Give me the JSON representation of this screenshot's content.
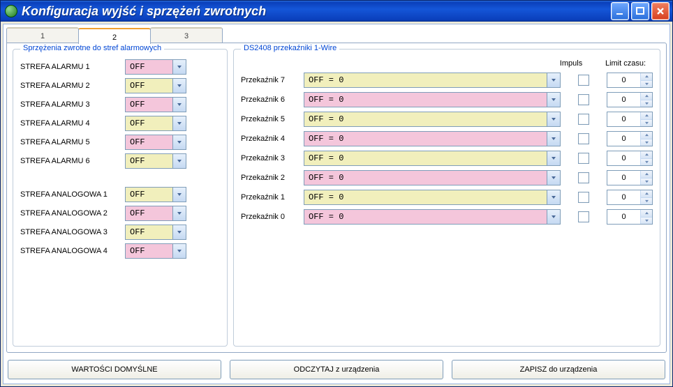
{
  "window": {
    "title": "Konfiguracja wyjść i sprzężeń zwrotnych"
  },
  "tabs": [
    "1",
    "2",
    "3"
  ],
  "active_tab": 1,
  "left_group": {
    "legend": "Sprzężenia zwrotne do stref alarmowych",
    "alarm": [
      {
        "label": "STREFA ALARMU 1",
        "value": "OFF",
        "color": "pink"
      },
      {
        "label": "STREFA ALARMU 2",
        "value": "OFF",
        "color": "yellow"
      },
      {
        "label": "STREFA ALARMU 3",
        "value": "OFF",
        "color": "pink"
      },
      {
        "label": "STREFA ALARMU 4",
        "value": "OFF",
        "color": "yellow"
      },
      {
        "label": "STREFA ALARMU 5",
        "value": "OFF",
        "color": "pink"
      },
      {
        "label": "STREFA ALARMU 6",
        "value": "OFF",
        "color": "yellow"
      }
    ],
    "analog": [
      {
        "label": "STREFA ANALOGOWA 1",
        "value": "OFF",
        "color": "yellow"
      },
      {
        "label": "STREFA ANALOGOWA 2",
        "value": "OFF",
        "color": "pink"
      },
      {
        "label": "STREFA ANALOGOWA 3",
        "value": "OFF",
        "color": "yellow"
      },
      {
        "label": "STREFA ANALOGOWA 4",
        "value": "OFF",
        "color": "pink"
      }
    ]
  },
  "right_group": {
    "legend": "DS2408 przekaźniki 1-Wire",
    "head_impuls": "Impuls",
    "head_limit": "Limit czasu:",
    "rows": [
      {
        "label": "Przekaźnik 7",
        "value": "OFF = 0",
        "color": "yellow",
        "impuls": false,
        "limit": "0"
      },
      {
        "label": "Przekaźnik 6",
        "value": "OFF = 0",
        "color": "pink",
        "impuls": false,
        "limit": "0"
      },
      {
        "label": "Przekaźnik 5",
        "value": "OFF = 0",
        "color": "yellow",
        "impuls": false,
        "limit": "0"
      },
      {
        "label": "Przekaźnik 4",
        "value": "OFF = 0",
        "color": "pink",
        "impuls": false,
        "limit": "0"
      },
      {
        "label": "Przekaźnik 3",
        "value": "OFF = 0",
        "color": "yellow",
        "impuls": false,
        "limit": "0"
      },
      {
        "label": "Przekaźnik 2",
        "value": "OFF = 0",
        "color": "pink",
        "impuls": false,
        "limit": "0"
      },
      {
        "label": "Przekaźnik 1",
        "value": "OFF = 0",
        "color": "yellow",
        "impuls": false,
        "limit": "0"
      },
      {
        "label": "Przekaźnik 0",
        "value": "OFF = 0",
        "color": "pink",
        "impuls": false,
        "limit": "0"
      }
    ]
  },
  "buttons": {
    "defaults": "WARTOŚCI DOMYŚLNE",
    "read": "ODCZYTAJ z urządzenia",
    "write": "ZAPISZ do urządzenia"
  }
}
